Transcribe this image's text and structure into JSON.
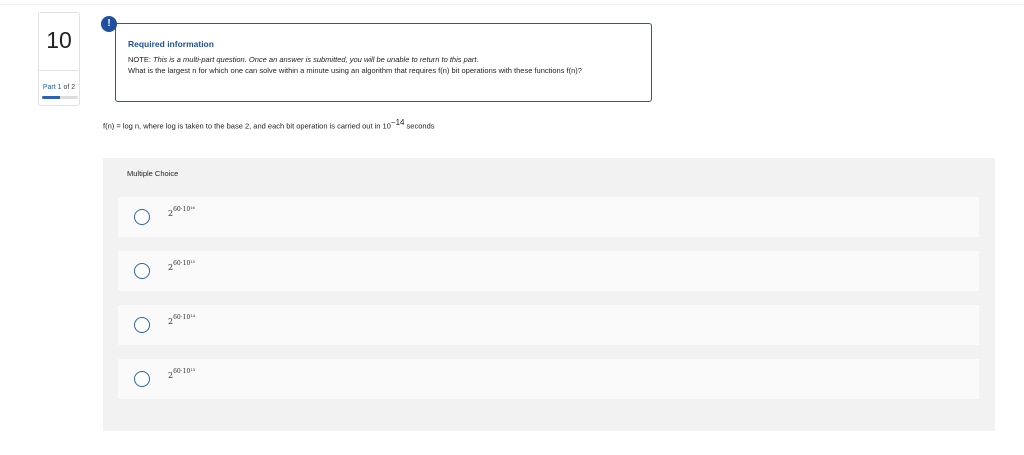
{
  "question": {
    "number": "10",
    "part_current": "Part 1",
    "part_of": "of 2",
    "progress": 0.5
  },
  "info": {
    "icon": "!",
    "title": "Required information",
    "note_prefix": "NOTE: ",
    "note_italic": "This is a multi-part question. Once an answer is submitted, you will be unable to return to this part.",
    "question_text": "What is the largest n for which one can solve within a minute using an algorithm that requires f(n) bit operations with these functions f(n)?"
  },
  "stem": {
    "text": "f(n) = log n, where log is taken to the base 2, and each bit operation is carried out in 10",
    "exponent": "−14",
    "suffix": " seconds"
  },
  "multiple_choice": {
    "label": "Multiple Choice",
    "options": [
      {
        "base": "2",
        "exponent": "60·10¹⁶"
      },
      {
        "base": "2",
        "exponent": "60·10¹⁵"
      },
      {
        "base": "2",
        "exponent": "60·10¹⁴"
      },
      {
        "base": "2",
        "exponent": "60·10¹³"
      }
    ]
  },
  "colors": {
    "accent": "#1f5aa6",
    "panel": "#f2f2f2"
  }
}
